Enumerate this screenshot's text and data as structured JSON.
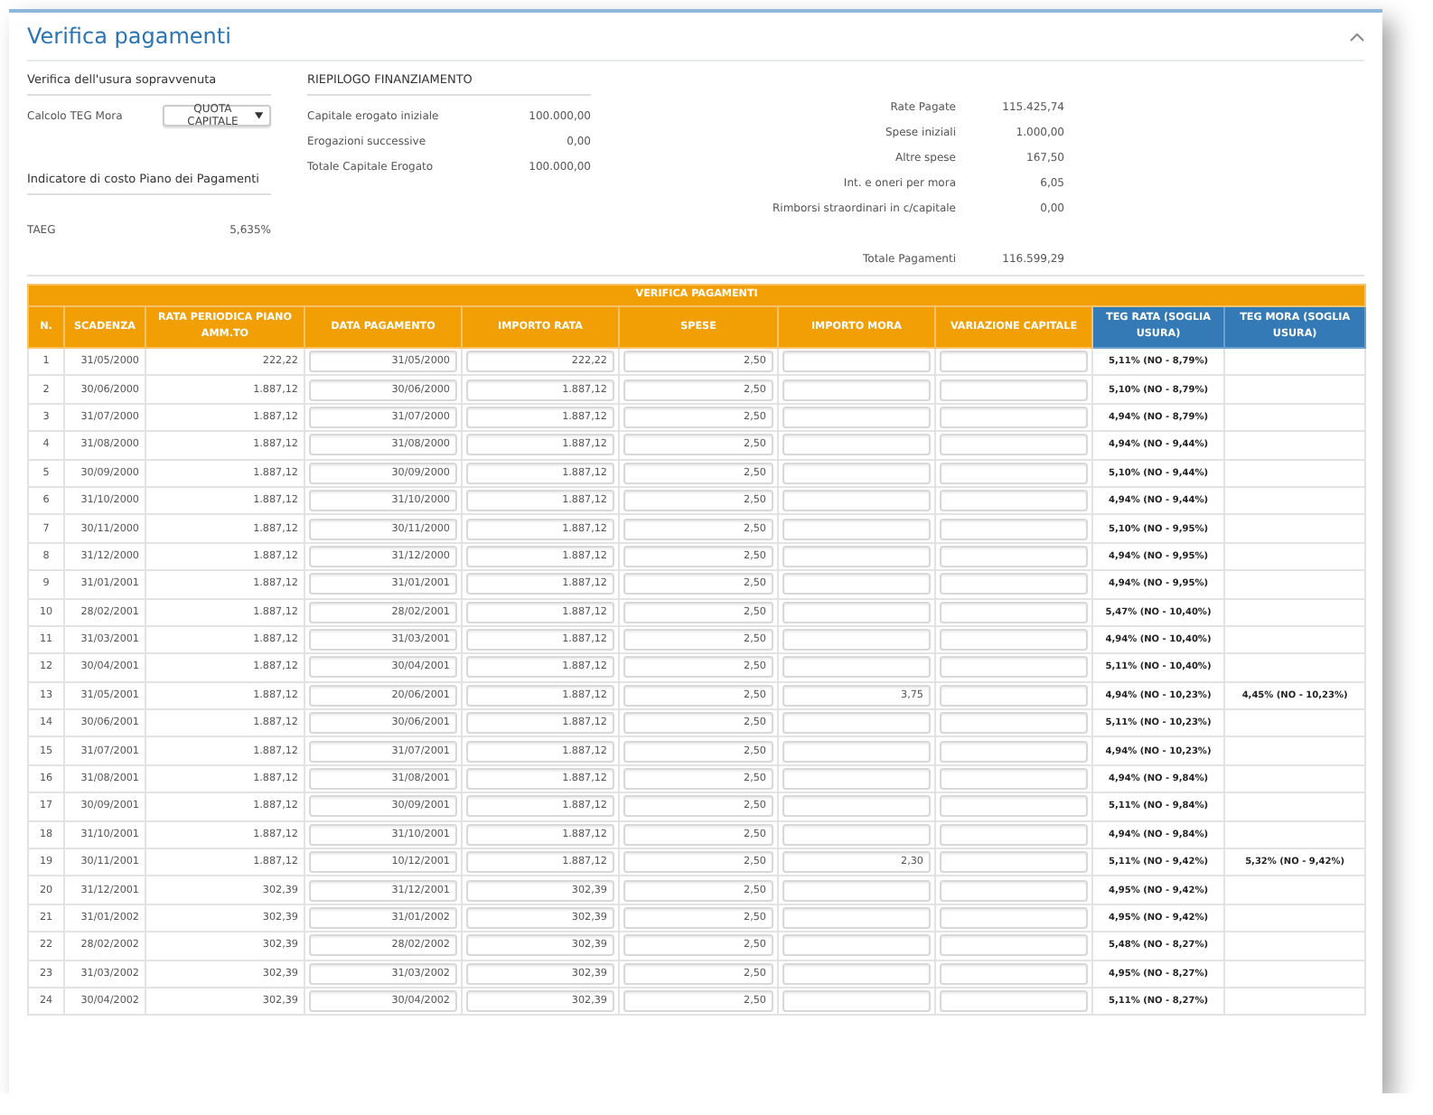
{
  "panel": {
    "title": "Verifica pagamenti"
  },
  "usury_check": {
    "heading": "Verifica dell'usura sopravvenuta",
    "field_label": "Calcolo TEG Mora",
    "select_value": "QUOTA CAPITALE"
  },
  "cost_indicator": {
    "heading": "Indicatore di costo Piano dei Pagamenti",
    "label": "TAEG",
    "value": "5,635%"
  },
  "financing_summary": {
    "heading": "RIEPILOGO FINANZIAMENTO",
    "left": [
      {
        "label": "Capitale erogato iniziale",
        "value": "100.000,00"
      },
      {
        "label": "Erogazioni successive",
        "value": "0,00"
      },
      {
        "label": "Totale Capitale Erogato",
        "value": "100.000,00"
      }
    ],
    "right": [
      {
        "label": "Rate Pagate",
        "value": "115.425,74"
      },
      {
        "label": "Spese iniziali",
        "value": "1.000,00"
      },
      {
        "label": "Altre spese",
        "value": "167,50"
      },
      {
        "label": "Int. e oneri per mora",
        "value": "6,05"
      },
      {
        "label": "Rimborsi straordinari in c/capitale",
        "value": "0,00"
      }
    ],
    "total": {
      "label": "Totale Pagamenti",
      "value": "116.599,29"
    }
  },
  "table": {
    "title": "VERIFICA PAGAMENTI",
    "columns": [
      {
        "label": "N.",
        "kind": "text"
      },
      {
        "label": "SCADENZA",
        "kind": "text"
      },
      {
        "label": "RATA PERIODICA PIANO AMM.TO",
        "kind": "text"
      },
      {
        "label": "DATA PAGAMENTO",
        "kind": "input"
      },
      {
        "label": "IMPORTO RATA",
        "kind": "input"
      },
      {
        "label": "SPESE",
        "kind": "input"
      },
      {
        "label": "IMPORTO MORA",
        "kind": "input"
      },
      {
        "label": "VARIAZIONE CAPITALE",
        "kind": "input"
      },
      {
        "label": "TEG RATA (SOGLIA USURA)",
        "kind": "teg"
      },
      {
        "label": "TEG MORA (SOGLIA USURA)",
        "kind": "teg"
      }
    ],
    "rows": [
      [
        "1",
        "31/05/2000",
        "222,22",
        "31/05/2000",
        "222,22",
        "2,50",
        null,
        null,
        "5,11% (NO - 8,79%)",
        null
      ],
      [
        "2",
        "30/06/2000",
        "1.887,12",
        "30/06/2000",
        "1.887,12",
        "2,50",
        null,
        null,
        "5,10% (NO - 8,79%)",
        null
      ],
      [
        "3",
        "31/07/2000",
        "1.887,12",
        "31/07/2000",
        "1.887,12",
        "2,50",
        null,
        null,
        "4,94% (NO - 8,79%)",
        null
      ],
      [
        "4",
        "31/08/2000",
        "1.887,12",
        "31/08/2000",
        "1.887,12",
        "2,50",
        null,
        null,
        "4,94% (NO - 9,44%)",
        null
      ],
      [
        "5",
        "30/09/2000",
        "1.887,12",
        "30/09/2000",
        "1.887,12",
        "2,50",
        null,
        null,
        "5,10% (NO - 9,44%)",
        null
      ],
      [
        "6",
        "31/10/2000",
        "1.887,12",
        "31/10/2000",
        "1.887,12",
        "2,50",
        null,
        null,
        "4,94% (NO - 9,44%)",
        null
      ],
      [
        "7",
        "30/11/2000",
        "1.887,12",
        "30/11/2000",
        "1.887,12",
        "2,50",
        null,
        null,
        "5,10% (NO - 9,95%)",
        null
      ],
      [
        "8",
        "31/12/2000",
        "1.887,12",
        "31/12/2000",
        "1.887,12",
        "2,50",
        null,
        null,
        "4,94% (NO - 9,95%)",
        null
      ],
      [
        "9",
        "31/01/2001",
        "1.887,12",
        "31/01/2001",
        "1.887,12",
        "2,50",
        null,
        null,
        "4,94% (NO - 9,95%)",
        null
      ],
      [
        "10",
        "28/02/2001",
        "1.887,12",
        "28/02/2001",
        "1.887,12",
        "2,50",
        null,
        null,
        "5,47% (NO - 10,40%)",
        null
      ],
      [
        "11",
        "31/03/2001",
        "1.887,12",
        "31/03/2001",
        "1.887,12",
        "2,50",
        null,
        null,
        "4,94% (NO - 10,40%)",
        null
      ],
      [
        "12",
        "30/04/2001",
        "1.887,12",
        "30/04/2001",
        "1.887,12",
        "2,50",
        null,
        null,
        "5,11% (NO - 10,40%)",
        null
      ],
      [
        "13",
        "31/05/2001",
        "1.887,12",
        "20/06/2001",
        "1.887,12",
        "2,50",
        "3,75",
        null,
        "4,94% (NO - 10,23%)",
        "4,45% (NO - 10,23%)"
      ],
      [
        "14",
        "30/06/2001",
        "1.887,12",
        "30/06/2001",
        "1.887,12",
        "2,50",
        null,
        null,
        "5,11% (NO - 10,23%)",
        null
      ],
      [
        "15",
        "31/07/2001",
        "1.887,12",
        "31/07/2001",
        "1.887,12",
        "2,50",
        null,
        null,
        "4,94% (NO - 10,23%)",
        null
      ],
      [
        "16",
        "31/08/2001",
        "1.887,12",
        "31/08/2001",
        "1.887,12",
        "2,50",
        null,
        null,
        "4,94% (NO - 9,84%)",
        null
      ],
      [
        "17",
        "30/09/2001",
        "1.887,12",
        "30/09/2001",
        "1.887,12",
        "2,50",
        null,
        null,
        "5,11% (NO - 9,84%)",
        null
      ],
      [
        "18",
        "31/10/2001",
        "1.887,12",
        "31/10/2001",
        "1.887,12",
        "2,50",
        null,
        null,
        "4,94% (NO - 9,84%)",
        null
      ],
      [
        "19",
        "30/11/2001",
        "1.887,12",
        "10/12/2001",
        "1.887,12",
        "2,50",
        "2,30",
        null,
        "5,11% (NO - 9,42%)",
        "5,32% (NO - 9,42%)"
      ],
      [
        "20",
        "31/12/2001",
        "302,39",
        "31/12/2001",
        "302,39",
        "2,50",
        null,
        null,
        "4,95% (NO - 9,42%)",
        null
      ],
      [
        "21",
        "31/01/2002",
        "302,39",
        "31/01/2002",
        "302,39",
        "2,50",
        null,
        null,
        "4,95% (NO - 9,42%)",
        null
      ],
      [
        "22",
        "28/02/2002",
        "302,39",
        "28/02/2002",
        "302,39",
        "2,50",
        null,
        null,
        "5,48% (NO - 8,27%)",
        null
      ],
      [
        "23",
        "31/03/2002",
        "302,39",
        "31/03/2002",
        "302,39",
        "2,50",
        null,
        null,
        "4,95% (NO - 8,27%)",
        null
      ],
      [
        "24",
        "30/04/2002",
        "302,39",
        "30/04/2002",
        "302,39",
        "2,50",
        null,
        null,
        "5,11% (NO - 8,27%)",
        null
      ]
    ]
  }
}
